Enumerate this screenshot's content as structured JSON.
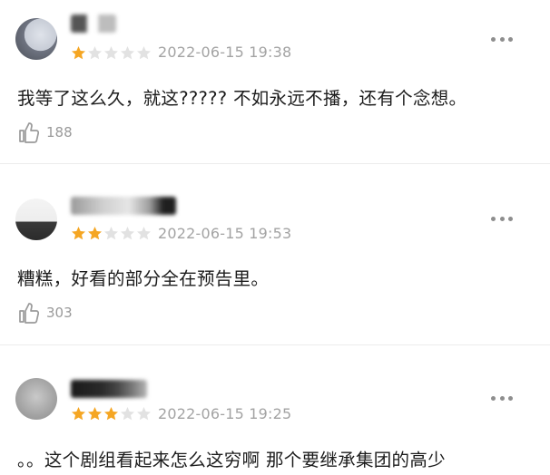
{
  "comments": [
    {
      "rating": 1,
      "time": "2022-06-15 19:38",
      "text": "我等了这么久，就这????? 不如永远不播，还有个念想。",
      "likes": "188"
    },
    {
      "rating": 2,
      "time": "2022-06-15 19:53",
      "text": "糟糕，好看的部分全在预告里。",
      "likes": "303"
    },
    {
      "rating": 3,
      "time": "2022-06-15 19:25",
      "text": "。。这个剧组看起来怎么这穷啊 那个要继承集团的高少",
      "likes": ""
    }
  ],
  "colors": {
    "star_filled": "#f5a623",
    "star_empty": "#e2e2e2",
    "timestamp": "#a3a3a3",
    "divider": "#ececec"
  },
  "icons": {
    "like": "thumbs-up-icon",
    "more": "more-dots-icon",
    "star": "star-icon"
  }
}
